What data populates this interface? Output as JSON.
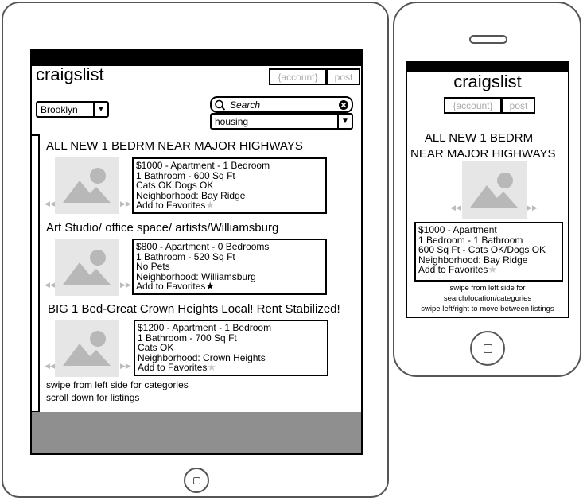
{
  "app": {
    "logo": "craigslist",
    "account_label": "{account}",
    "post_label": "post"
  },
  "tablet": {
    "location_value": "Brooklyn",
    "search_placeholder": "Search",
    "category_value": "housing",
    "listings": [
      {
        "title": "ALL NEW 1 BEDRM NEAR MAJOR HIGHWAYS",
        "line1": "$1000 - Apartment - 1 Bedroom",
        "line2": "1 Bathroom - 600 Sq Ft",
        "line3": "Cats OK Dogs OK",
        "line4": "Neighborhood: Bay Ridge",
        "favorite_label": "Add to Favorites",
        "favorited": false
      },
      {
        "title": "Art Studio/ office space/ artists/Williamsburg",
        "line1": "$800 - Apartment - 0 Bedrooms",
        "line2": "1 Bathroom - 520 Sq Ft",
        "line3": "No Pets",
        "line4": "Neighborhood: Williamsburg",
        "favorite_label": "Add to Favorites",
        "favorited": true
      },
      {
        "title": "BIG 1 Bed-Great Crown Heights Local! Rent Stabilized!",
        "line1": "$1200 - Apartment - 1 Bedroom",
        "line2": "1 Bathroom - 700 Sq Ft",
        "line3": "Cats OK",
        "line4": "Neighborhood: Crown Heights",
        "favorite_label": "Add to Favorites",
        "favorited": false
      }
    ],
    "hint1": "swipe from left side for categories",
    "hint2": "scroll down for listings"
  },
  "phone": {
    "title_line1": "ALL NEW 1 BEDRM",
    "title_line2": "NEAR MAJOR HIGHWAYS",
    "detail1": "$1000 - Apartment",
    "detail2": "1 Bedroom - 1 Bathroom",
    "detail3": "600 Sq Ft - Cats OK/Dogs OK",
    "detail4": "Neighborhood: Bay Ridge",
    "favorite_label": "Add to Favorites",
    "hint1": "swipe from left side for",
    "hint2": "search/location/categories",
    "hint3": "swipe left/right to move between listings"
  },
  "icons": {
    "star_empty": "star-outline-icon",
    "star_filled": "star-filled-icon",
    "image_placeholder": "image-placeholder-icon",
    "search": "search-icon",
    "clear": "clear-icon",
    "dropdown": "chevron-down-icon"
  },
  "colors": {
    "star_empty": "#c8c8c8",
    "star_filled": "#000000",
    "placeholder_bg": "#e6e6e6",
    "placeholder_shape": "#b8b8b8",
    "footer_gray": "#8f8f8f"
  }
}
